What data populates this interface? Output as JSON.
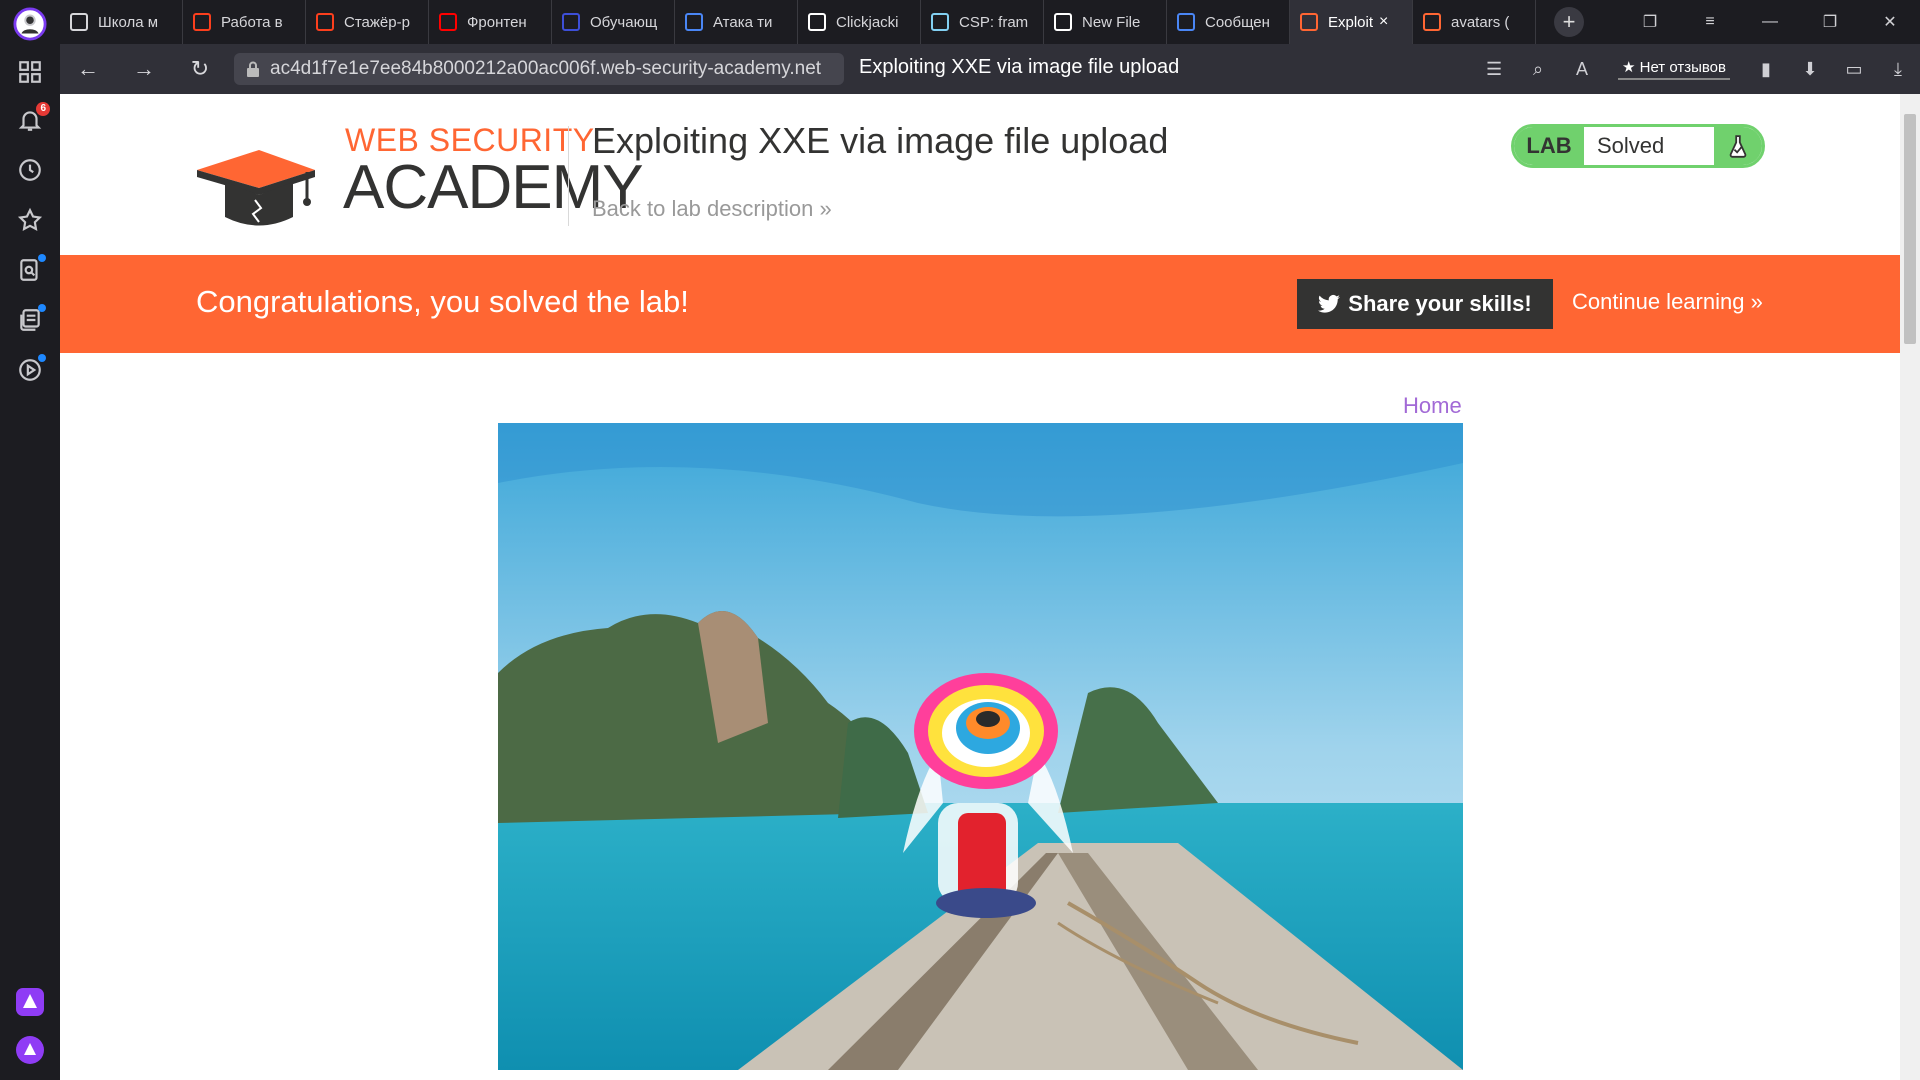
{
  "browser": {
    "tabs": [
      {
        "label": "Школа м",
        "icon": "document-icon",
        "color": "#d6d6da"
      },
      {
        "label": "Работа в",
        "icon": "yandex-icon",
        "color": "#fc3f1d"
      },
      {
        "label": "Стажёр-р",
        "icon": "yandex-icon",
        "color": "#fc3f1d"
      },
      {
        "label": "Фронтен",
        "icon": "youtube-icon",
        "color": "#ff0000"
      },
      {
        "label": "Обучающ",
        "icon": "stepik-icon",
        "color": "#3d4fd8"
      },
      {
        "label": "Атака ти",
        "icon": "docs-icon",
        "color": "#4a86f5"
      },
      {
        "label": "Clickjacki",
        "icon": "clickjacking-icon",
        "color": "#ffffff"
      },
      {
        "label": "CSP: fram",
        "icon": "mdn-icon",
        "color": "#83d0f2"
      },
      {
        "label": "New File",
        "icon": "github-icon",
        "color": "#ffffff"
      },
      {
        "label": "Сообщен",
        "icon": "chat-icon",
        "color": "#4a86f5"
      },
      {
        "label": "Exploit",
        "icon": "portswigger-icon",
        "color": "#ff6633",
        "active": true
      },
      {
        "label": "avatars (",
        "icon": "portswigger-icon",
        "color": "#ff6633"
      }
    ],
    "url_host": "ac4d1f7e1e7ee84b8000212a00ac006f.web-security-academy.net",
    "page_title": "Exploiting XXE via image file upload",
    "reviews_label": "★ Нет отзывов",
    "notification_count": "6"
  },
  "header": {
    "logo_line1": "WEB SECURITY",
    "logo_line2": "ACADEMY",
    "lab_title": "Exploiting XXE via image file upload",
    "back_link": "Back to lab description",
    "lab_tag": "LAB",
    "lab_status": "Solved"
  },
  "banner": {
    "congrats": "Congratulations, you solved the lab!",
    "share_button": "Share your skills!",
    "continue_link": "Continue learning"
  },
  "content": {
    "home_link": "Home"
  },
  "colors": {
    "accent": "#ff6633",
    "solved_green": "#70d16d",
    "dark": "#333332",
    "link_purple": "#a26ad6"
  }
}
